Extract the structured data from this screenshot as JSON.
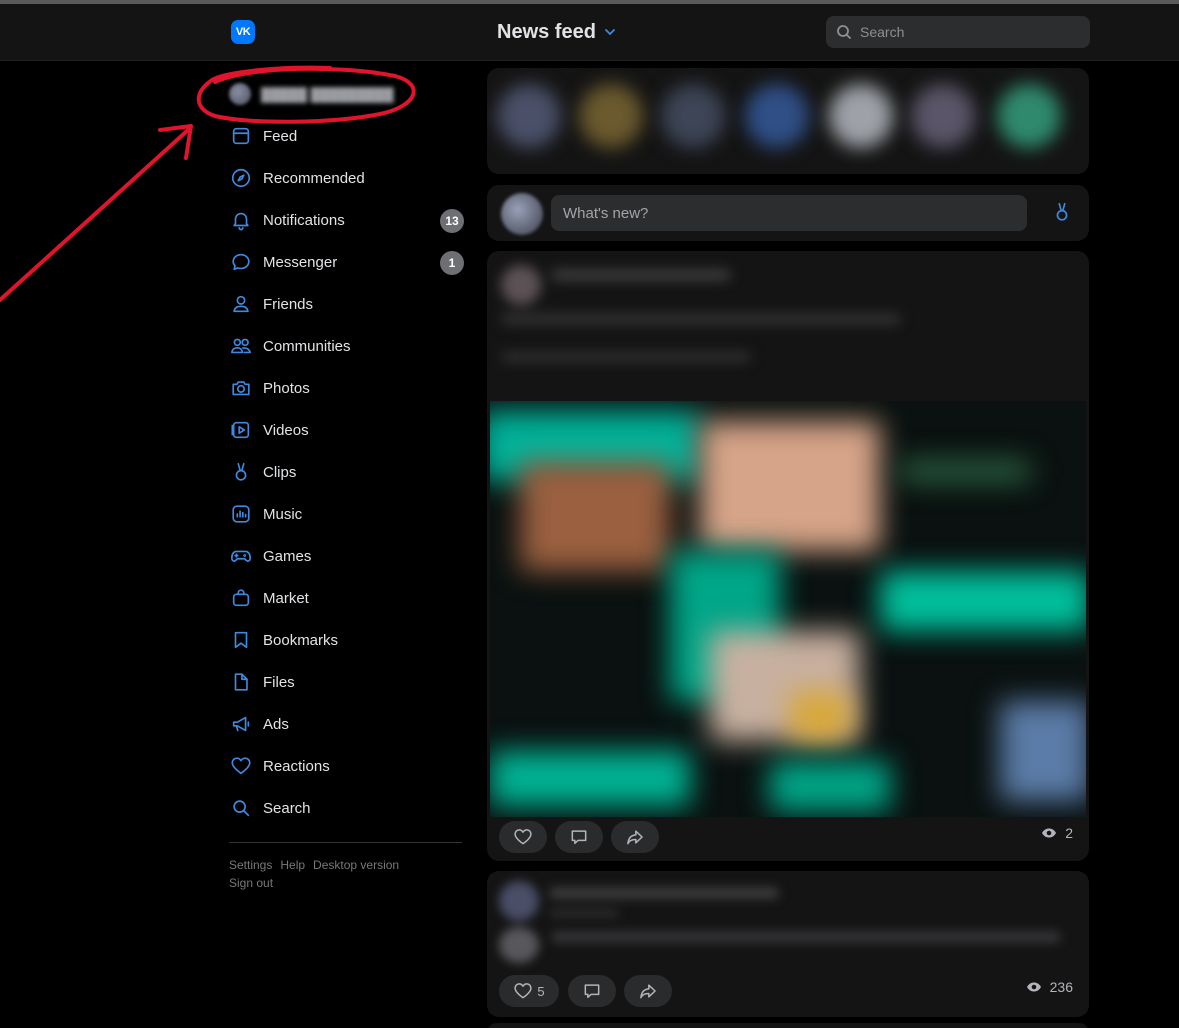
{
  "header": {
    "logo": "VK",
    "title": "News feed",
    "search_placeholder": "Search"
  },
  "sidebar": {
    "items": [
      {
        "id": "feed",
        "label": "Feed",
        "icon": "feed-icon"
      },
      {
        "id": "recommended",
        "label": "Recommended",
        "icon": "compass-icon"
      },
      {
        "id": "notifications",
        "label": "Notifications",
        "icon": "bell-icon",
        "badge": "13"
      },
      {
        "id": "messenger",
        "label": "Messenger",
        "icon": "chat-bubble-icon",
        "badge": "1"
      },
      {
        "id": "friends",
        "label": "Friends",
        "icon": "user-icon"
      },
      {
        "id": "communities",
        "label": "Communities",
        "icon": "users-icon"
      },
      {
        "id": "photos",
        "label": "Photos",
        "icon": "camera-icon"
      },
      {
        "id": "videos",
        "label": "Videos",
        "icon": "video-icon"
      },
      {
        "id": "clips",
        "label": "Clips",
        "icon": "clips-icon"
      },
      {
        "id": "music",
        "label": "Music",
        "icon": "music-icon"
      },
      {
        "id": "games",
        "label": "Games",
        "icon": "gamepad-icon"
      },
      {
        "id": "market",
        "label": "Market",
        "icon": "bag-icon"
      },
      {
        "id": "bookmarks",
        "label": "Bookmarks",
        "icon": "bookmark-icon"
      },
      {
        "id": "files",
        "label": "Files",
        "icon": "file-icon"
      },
      {
        "id": "ads",
        "label": "Ads",
        "icon": "megaphone-icon"
      },
      {
        "id": "reactions",
        "label": "Reactions",
        "icon": "heart-icon"
      },
      {
        "id": "search",
        "label": "Search",
        "icon": "search-icon"
      }
    ],
    "footer": {
      "settings": "Settings",
      "help": "Help",
      "desktop": "Desktop version",
      "signout": "Sign out"
    }
  },
  "compose": {
    "placeholder": "What's new?"
  },
  "posts": [
    {
      "views": "2",
      "likes": ""
    },
    {
      "views": "236",
      "likes": "5"
    }
  ],
  "colors": {
    "accent": "#3f8ae0",
    "annotation": "#e0142c",
    "background": "#000000",
    "card": "#141414"
  }
}
